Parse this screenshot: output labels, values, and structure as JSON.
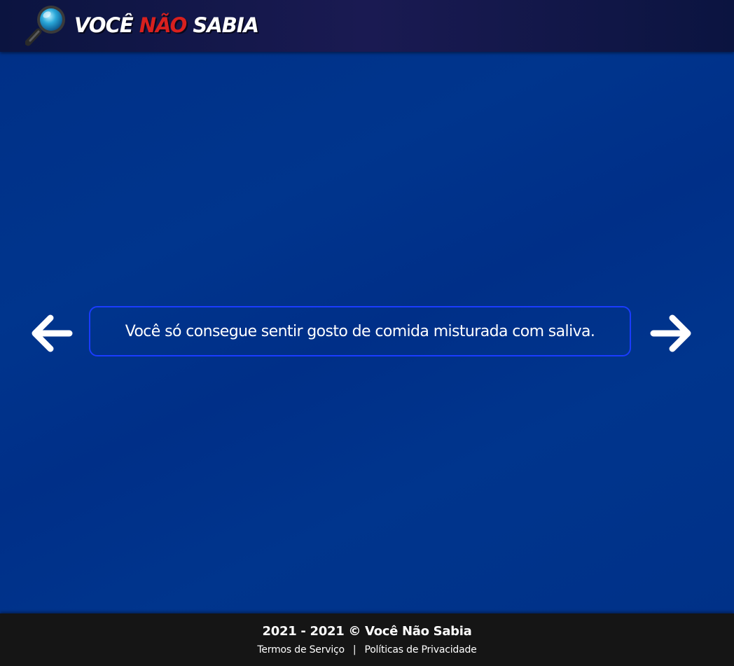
{
  "header": {
    "logo": {
      "word1": "Você",
      "word2": "Não",
      "word3": "Sabia",
      "icon": "magnifying-glass-icon"
    }
  },
  "main": {
    "fact": "Você só consegue sentir gosto de comida misturada com saliva.",
    "prev_icon": "arrow-left-icon",
    "next_icon": "arrow-right-icon"
  },
  "footer": {
    "copyright": "2021 - 2021 © Você Não Sabia",
    "links": {
      "terms": "Termos de Serviço",
      "separator": "|",
      "privacy": "Políticas de Privacidade"
    }
  },
  "colors": {
    "background": "#00348c",
    "header": "#111445",
    "accent_red": "#d8201e",
    "box_border": "#1a3cff",
    "footer": "#151515"
  }
}
